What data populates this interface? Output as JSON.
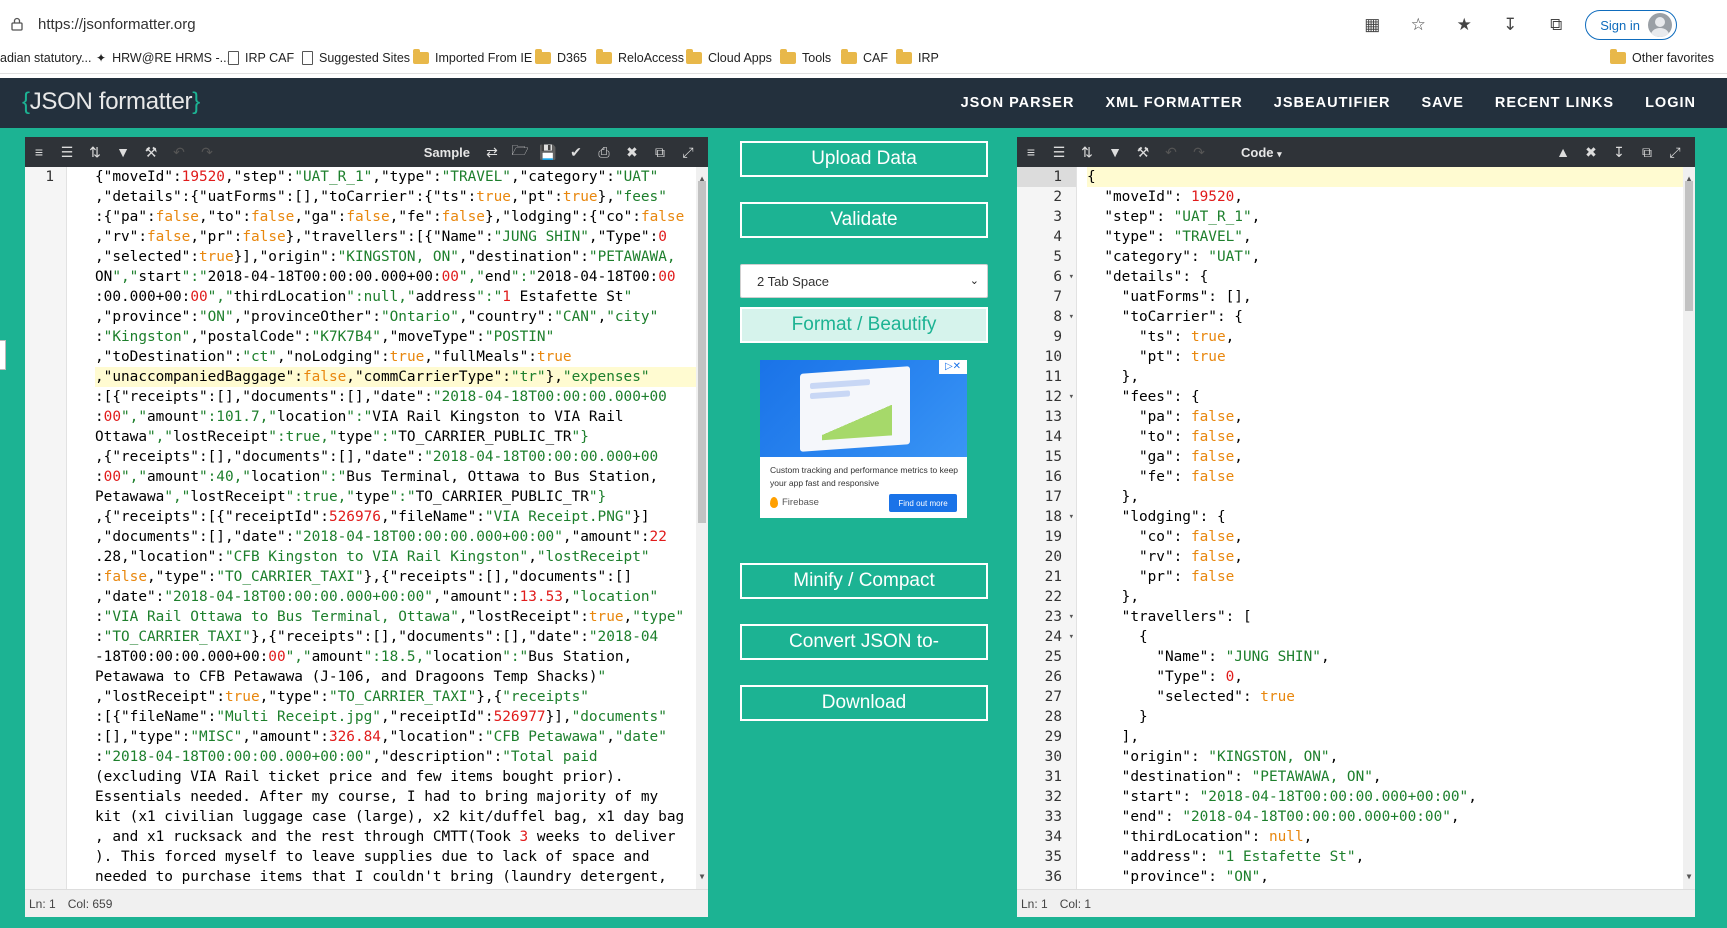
{
  "browser": {
    "url": "https://jsonformatter.org",
    "sign_in": "Sign in",
    "favorites": [
      {
        "label": "adian statutory...",
        "icon": "none"
      },
      {
        "label": "HRW@RE HRMS -...",
        "icon": "link"
      },
      {
        "label": "IRP CAF",
        "icon": "doc"
      },
      {
        "label": "Suggested Sites",
        "icon": "doc"
      },
      {
        "label": "Imported From IE",
        "icon": "folder"
      },
      {
        "label": "D365",
        "icon": "folder"
      },
      {
        "label": "ReloAccess",
        "icon": "folder"
      },
      {
        "label": "Cloud Apps",
        "icon": "folder"
      },
      {
        "label": "Tools",
        "icon": "folder"
      },
      {
        "label": "CAF",
        "icon": "folder"
      },
      {
        "label": "IRP",
        "icon": "folder"
      }
    ],
    "other_favorites": "Other favorites"
  },
  "site": {
    "logo": "JSON formatter",
    "nav": [
      "JSON PARSER",
      "XML FORMATTER",
      "JSBEAUTIFIER",
      "SAVE",
      "RECENT LINKS",
      "LOGIN"
    ]
  },
  "left_editor": {
    "toolbar_label": "Sample",
    "gutter_line": "1",
    "status_ln": "Ln: 1",
    "status_col": "Col: 659"
  },
  "right_editor": {
    "toolbar_label": "Code",
    "status_ln": "Ln: 1",
    "status_col": "Col: 1"
  },
  "middle": {
    "upload": "Upload Data",
    "validate": "Validate",
    "tab_select": "2 Tab Space",
    "format": "Format / Beautify",
    "minify": "Minify / Compact",
    "convert": "Convert JSON to-",
    "download": "Download"
  },
  "ad": {
    "text": "Custom tracking and performance metrics to keep your app fast and responsive",
    "brand": "Firebase",
    "cta": "Find out more"
  },
  "colors": {
    "teal": "#1cb393",
    "header": "#23303d",
    "toolbar": "#2f3338"
  },
  "icons": {
    "lock": "lock-icon",
    "tb_left": [
      "format-icon",
      "compact-icon",
      "sort-icon",
      "filter-icon",
      "wrench-icon",
      "undo-icon",
      "redo-icon"
    ],
    "tb_left_right": [
      "sample-link-icon",
      "open-folder-icon",
      "save-icon",
      "check-icon",
      "print-icon",
      "clear-icon",
      "copy-icon",
      "fullscreen-icon"
    ],
    "tb_right_right": [
      "pin-icon",
      "clear-icon",
      "download-icon",
      "copy-icon",
      "fullscreen-icon"
    ]
  },
  "left_code_lines": [
    "{\"moveId\":19520,\"step\":\"UAT_R_1\",\"type\":\"TRAVEL\",\"category\":\"UAT\"",
    ",\"details\":{\"uatForms\":[],\"toCarrier\":{\"ts\":true,\"pt\":true},\"fees\"",
    ":{\"pa\":false,\"to\":false,\"ga\":false,\"fe\":false},\"lodging\":{\"co\":false",
    ",\"rv\":false,\"pr\":false},\"travellers\":[{\"Name\":\"JUNG SHIN\",\"Type\":0",
    ",\"selected\":true}],\"origin\":\"KINGSTON, ON\",\"destination\":\"PETAWAWA,",
    "ON\",\"start\":\"2018-04-18T00:00:00.000+00:00\",\"end\":\"2018-04-18T00:00",
    ":00.000+00:00\",\"thirdLocation\":null,\"address\":\"1 Estafette St\"",
    ",\"province\":\"ON\",\"provinceOther\":\"Ontario\",\"country\":\"CAN\",\"city\"",
    ":\"Kingston\",\"postalCode\":\"K7K7B4\",\"moveType\":\"POSTIN\"",
    ",\"toDestination\":\"ct\",\"noLodging\":true,\"fullMeals\":true",
    ",\"unaccompaniedBaggage\":false,\"commCarrierType\":\"tr\"},\"expenses\"",
    ":[{\"receipts\":[],\"documents\":[],\"date\":\"2018-04-18T00:00:00.000+00",
    ":00\",\"amount\":101.7,\"location\":\"VIA Rail Kingston to VIA Rail",
    "Ottawa\",\"lostReceipt\":true,\"type\":\"TO_CARRIER_PUBLIC_TR\"}",
    ",{\"receipts\":[],\"documents\":[],\"date\":\"2018-04-18T00:00:00.000+00",
    ":00\",\"amount\":40,\"location\":\"Bus Terminal, Ottawa to Bus Station,",
    "Petawawa\",\"lostReceipt\":true,\"type\":\"TO_CARRIER_PUBLIC_TR\"}",
    ",{\"receipts\":[{\"receiptId\":526976,\"fileName\":\"VIA Receipt.PNG\"}]",
    ",\"documents\":[],\"date\":\"2018-04-18T00:00:00.000+00:00\",\"amount\":22",
    ".28,\"location\":\"CFB Kingston to VIA Rail Kingston\",\"lostReceipt\"",
    ":false,\"type\":\"TO_CARRIER_TAXI\"},{\"receipts\":[],\"documents\":[]",
    ",\"date\":\"2018-04-18T00:00:00.000+00:00\",\"amount\":13.53,\"location\"",
    ":\"VIA Rail Ottawa to Bus Terminal, Ottawa\",\"lostReceipt\":true,\"type\"",
    ":\"TO_CARRIER_TAXI\"},{\"receipts\":[],\"documents\":[],\"date\":\"2018-04",
    "-18T00:00:00.000+00:00\",\"amount\":18.5,\"location\":\"Bus Station,",
    "Petawawa to CFB Petawawa (J-106, and Dragoons Temp Shacks)\"",
    ",\"lostReceipt\":true,\"type\":\"TO_CARRIER_TAXI\"},{\"receipts\"",
    ":[{\"fileName\":\"Multi Receipt.jpg\",\"receiptId\":526977}],\"documents\"",
    ":[],\"type\":\"MISC\",\"amount\":326.84,\"location\":\"CFB Petawawa\",\"date\"",
    ":\"2018-04-18T00:00:00.000+00:00\",\"description\":\"Total paid",
    "(excluding VIA Rail ticket price and few items bought prior).",
    "Essentials needed. After my course, I had to bring majority of my",
    "kit (x1 civilian luggage case (large), x2 kit/duffel bag, x1 day bag",
    ", and x1 rucksack and the rest through CMTT(Took 3 weeks to deliver",
    "). This forced myself to leave supplies due to lack of space and",
    "needed to purchase items that I couldn't bring (laundry detergent,"
  ],
  "right_code_lines": [
    "{",
    "  \"moveId\": 19520,",
    "  \"step\": \"UAT_R_1\",",
    "  \"type\": \"TRAVEL\",",
    "  \"category\": \"UAT\",",
    "  \"details\": {",
    "    \"uatForms\": [],",
    "    \"toCarrier\": {",
    "      \"ts\": true,",
    "      \"pt\": true",
    "    },",
    "    \"fees\": {",
    "      \"pa\": false,",
    "      \"to\": false,",
    "      \"ga\": false,",
    "      \"fe\": false",
    "    },",
    "    \"lodging\": {",
    "      \"co\": false,",
    "      \"rv\": false,",
    "      \"pr\": false",
    "    },",
    "    \"travellers\": [",
    "      {",
    "        \"Name\": \"JUNG SHIN\",",
    "        \"Type\": 0,",
    "        \"selected\": true",
    "      }",
    "    ],",
    "    \"origin\": \"KINGSTON, ON\",",
    "    \"destination\": \"PETAWAWA, ON\",",
    "    \"start\": \"2018-04-18T00:00:00.000+00:00\",",
    "    \"end\": \"2018-04-18T00:00:00.000+00:00\",",
    "    \"thirdLocation\": null,",
    "    \"address\": \"1 Estafette St\",",
    "    \"province\": \"ON\","
  ],
  "right_fold_lines": [
    6,
    8,
    12,
    18,
    23,
    24
  ]
}
